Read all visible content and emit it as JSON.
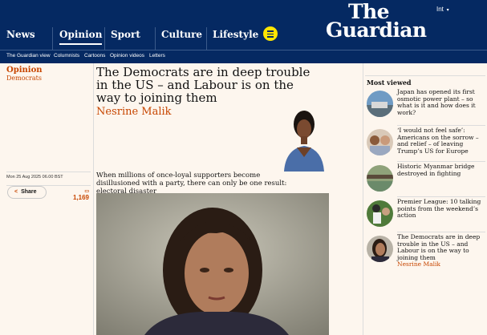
{
  "edition": "Int",
  "brand": {
    "line1": "The",
    "line2": "Guardian"
  },
  "nav": [
    {
      "label": "News"
    },
    {
      "label": "Opinion"
    },
    {
      "label": "Sport"
    },
    {
      "label": "Culture"
    },
    {
      "label": "Lifestyle"
    }
  ],
  "subnav": [
    "The Guardian view",
    "Columnists",
    "Cartoons",
    "Opinion videos",
    "Letters"
  ],
  "article": {
    "section": "Opinion",
    "series": "Democrats",
    "headline": "The Democrats are in deep trouble in the US – and Labour is on the way to joining them",
    "byline": "Nesrine Malik",
    "standfirst": "When millions of once-loyal supporters become disillusioned with a party, there can only be one result: electoral disaster",
    "date": "Mon 25 Aug 2025 06.00 BST",
    "share_label": "Share",
    "comment_count": "1,169"
  },
  "most_viewed": {
    "title": "Most viewed",
    "items": [
      {
        "text": "Japan has opened its first osmotic power plant – so what is it and how does it work?"
      },
      {
        "text": "‘I would not feel safe’: Americans on the sorrow – and relief – of leaving Trump’s US for Europe"
      },
      {
        "text": "Historic Myanmar bridge destroyed in fighting"
      },
      {
        "text": "Premier League: 10 talking points from the weekend’s action"
      },
      {
        "text": "The Democrats are in deep trouble in the US – and Labour is on the way to joining them",
        "author": "Nesrine Malik"
      }
    ]
  },
  "colors": {
    "brand": "#052962",
    "opinion": "#c74600",
    "background": "#fdf6ee",
    "menu_button": "#ffe500"
  },
  "icons": {
    "share": "share-icon",
    "comments": "comment-icon",
    "menu": "menu-icon",
    "chevron": "chevron-down-icon"
  }
}
